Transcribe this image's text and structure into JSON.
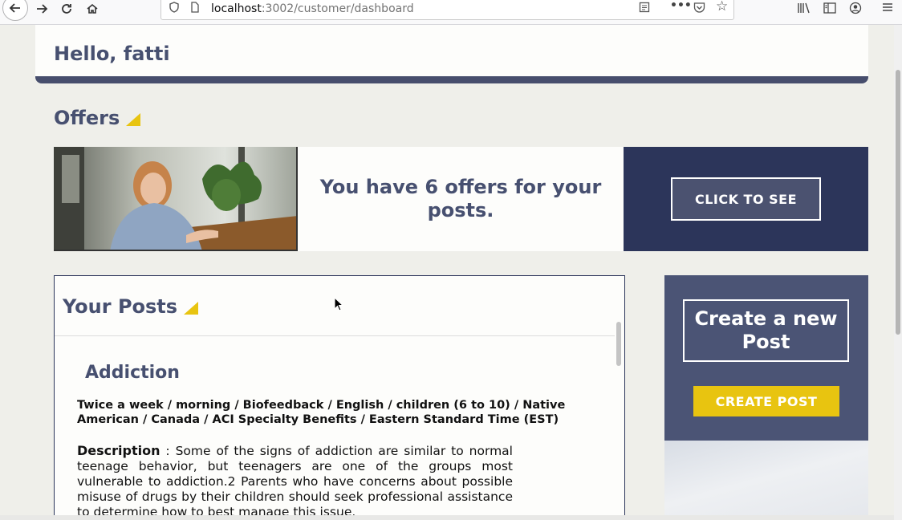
{
  "browser": {
    "url_host": "localhost",
    "url_rest": ":3002/customer/dashboard"
  },
  "header": {
    "greeting": "Hello, fatti"
  },
  "offers": {
    "title": "Offers",
    "message": "You have 6 offers for your posts.",
    "cta_label": "CLICK TO SEE"
  },
  "posts": {
    "title": "Your Posts",
    "items": [
      {
        "title": "Addiction",
        "meta": "Twice a week / morning / Biofeedback / English / children (6 to 10) / Native American / Canada / ACI Specialty Benefits / Eastern Standard Time (EST)",
        "description_label": "Description",
        "description": " : Some of the signs of addiction are similar to normal teenage behavior, but teenagers are one of the groups most vulnerable to addiction.2 Parents who have concerns about possible misuse of drugs by their children should seek professional assistance to determine how to best manage this issue."
      }
    ]
  },
  "create": {
    "heading": "Create a new Post",
    "button_label": "CREATE POST"
  },
  "colors": {
    "brand_navy": "#2c355a",
    "heading": "#475070",
    "accent_yellow": "#e8c410",
    "panel": "#4b5475"
  }
}
